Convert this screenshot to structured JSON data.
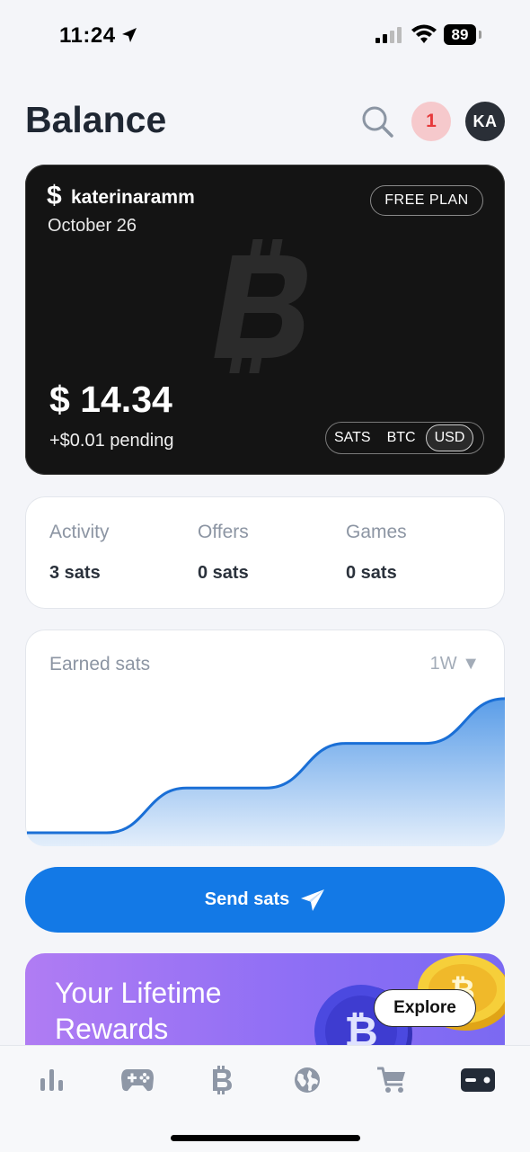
{
  "status_bar": {
    "time": "11:24",
    "battery": "89"
  },
  "header": {
    "title": "Balance",
    "notifications": "1",
    "avatar_initials": "KA"
  },
  "balance_card": {
    "currency_symbol": "$",
    "username": "katerinaramm",
    "date": "October 26",
    "plan": "FREE PLAN",
    "amount": "$ 14.34",
    "pending": "+$0.01 pending",
    "units": [
      "SATS",
      "BTC",
      "USD"
    ],
    "selected_unit": "USD"
  },
  "stats": [
    {
      "label": "Activity",
      "value": "3 sats"
    },
    {
      "label": "Offers",
      "value": "0 sats"
    },
    {
      "label": "Games",
      "value": "0 sats"
    }
  ],
  "earned_chart": {
    "title": "Earned sats",
    "period": "1W ▼"
  },
  "chart_data": {
    "type": "area",
    "title": "Earned sats",
    "x": [
      0,
      1,
      2,
      3,
      4,
      5,
      6
    ],
    "values": [
      0,
      0,
      1,
      1,
      2,
      2,
      3
    ],
    "ylim": [
      0,
      3.3
    ],
    "grid": false,
    "color": "#1a6fd6"
  },
  "send_button": {
    "label": "Send sats"
  },
  "rewards": {
    "title": "Your Lifetime Rewards",
    "cta": "Explore"
  },
  "bottom_nav": [
    "stats-icon",
    "gamepad-icon",
    "bitcoin-icon",
    "globe-icon",
    "cart-icon",
    "wallet-icon"
  ],
  "colors": {
    "accent": "#1379e6",
    "card_bg": "#141414",
    "notif_bg": "#f6c9cc",
    "notif_fg": "#e6393b"
  }
}
